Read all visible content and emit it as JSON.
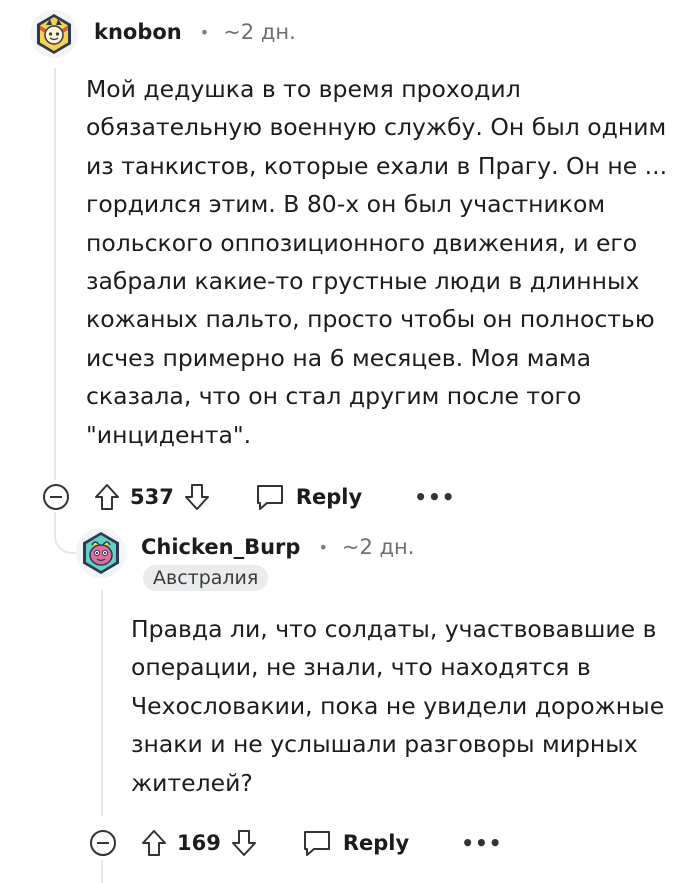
{
  "comment1": {
    "username": "knobon",
    "separator": "•",
    "timestamp": "~2 дн.",
    "body": "Мой дедушка в то время проходил обязательную военную службу. Он был одним из танкистов, которые ехали в Прагу. Он не ... гордился этим. В 80-х он был участником польского оппозиционного движения, и его забрали какие-то грустные люди в длинных кожаных пальто, просто чтобы он полностью исчез примерно на 6 месяцев. Моя мама сказала, что он стал другим после того \"инцидента\".",
    "score": "537",
    "reply_label": "Reply",
    "more_label": "•••",
    "avatar_icon": "avatar-icon"
  },
  "comment2": {
    "username": "Chicken_Burp",
    "separator": "•",
    "timestamp": "~2 дн.",
    "flair": "Австралия",
    "body": "Правда ли, что солдаты, участвовавшие в операции, не знали, что находятся в Чехословакии, пока не увидели дорожные знаки и не услышали разговоры мирных жителей?",
    "score": "169",
    "reply_label": "Reply",
    "more_label": "•••",
    "avatar_icon": "avatar-icon"
  },
  "colors": {
    "thread_line": "#e4e6e8",
    "flair_bg": "#e9ebed",
    "text": "#1c1c1c",
    "meta": "#6f6f6f"
  }
}
